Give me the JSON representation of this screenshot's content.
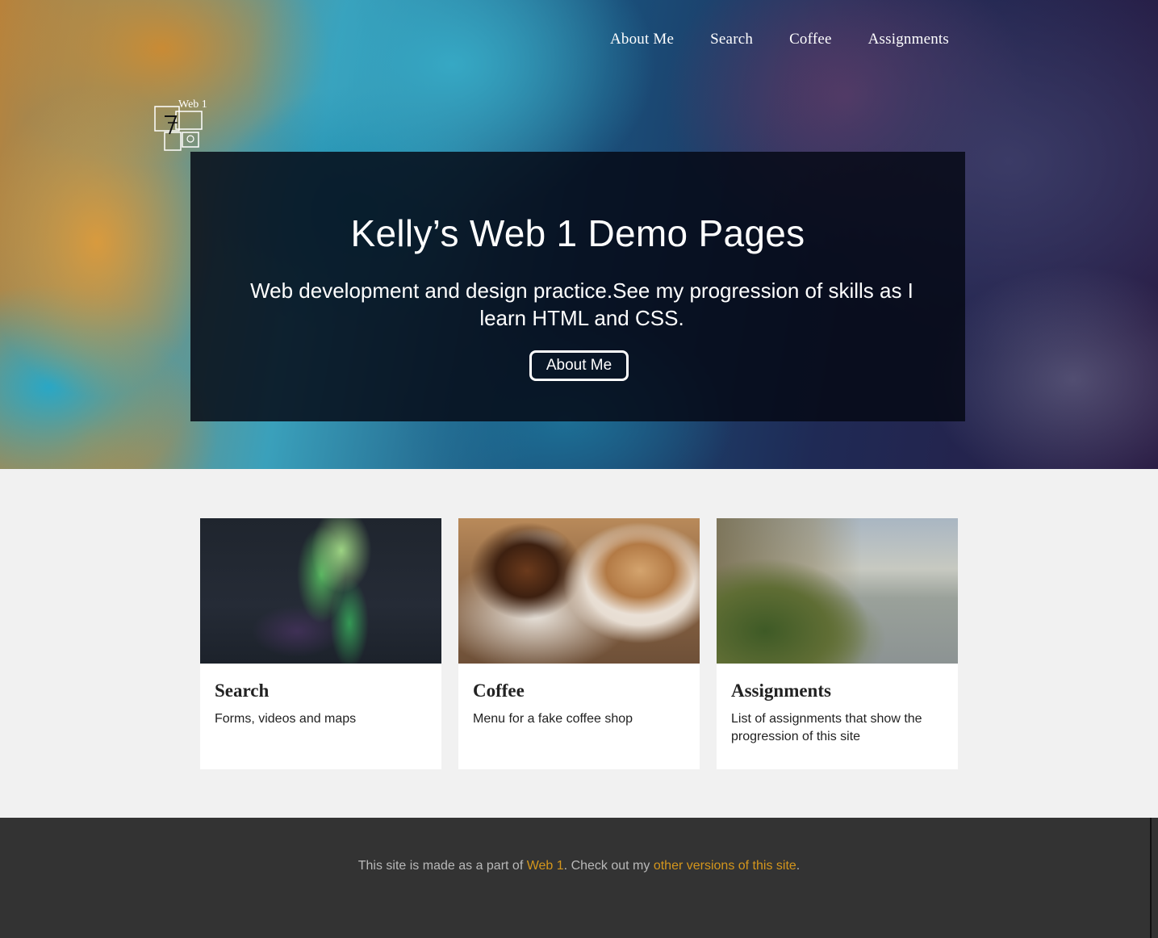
{
  "nav": {
    "items": [
      "About Me",
      "Search",
      "Coffee",
      "Assignments"
    ]
  },
  "logo": {
    "text": "Web 1",
    "icon": "web1-logo-icon"
  },
  "hero": {
    "title": "Kelly’s Web 1 Demo Pages",
    "subtitle": "Web development and design practice.See my progression of skills as I learn HTML and CSS.",
    "button_label": "About Me"
  },
  "cards": [
    {
      "title": "Search",
      "description": "Forms, videos and maps",
      "image": "aurora-photo"
    },
    {
      "title": "Coffee",
      "description": "Menu for a fake coffee shop",
      "image": "coffee-cake-photo"
    },
    {
      "title": "Assignments",
      "description": "List of assignments that show the progression of this site",
      "image": "coastline-photo"
    }
  ],
  "footer": {
    "text_1": "This site is made as a part of ",
    "link_1": "Web 1",
    "text_2": ". Check out my ",
    "link_2": "other versions of this site",
    "text_3": "."
  },
  "colors": {
    "footer_bg": "#333333",
    "footer_link": "#d4961c",
    "page_bg": "#f1f1f1",
    "hero_panel": "#050814"
  }
}
